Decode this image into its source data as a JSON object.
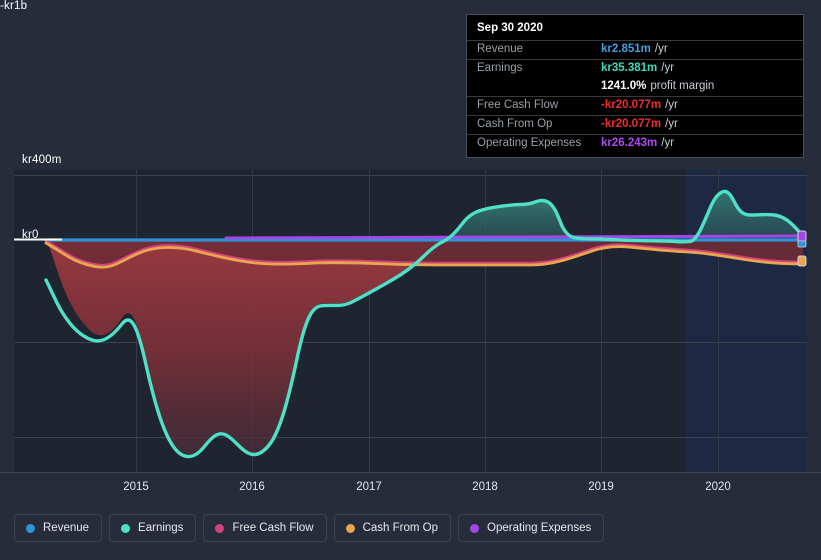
{
  "chart_data": {
    "type": "area",
    "title": "",
    "xlabel": "",
    "ylabel": "",
    "ylim": [
      -1000,
      400
    ],
    "y_ticks": [
      {
        "value": 400,
        "label": "kr400m"
      },
      {
        "value": 0,
        "label": "kr0"
      },
      {
        "value": -1000,
        "label": "-kr1b"
      }
    ],
    "x_ticks": [
      "2015",
      "2016",
      "2017",
      "2018",
      "2019",
      "2020"
    ],
    "grid": true,
    "legend_position": "bottom",
    "currency_prefix": "kr",
    "units": "millions",
    "forecast_start": "2019-10",
    "x": [
      "2014-06",
      "2014-09",
      "2014-12",
      "2015-03",
      "2015-06",
      "2015-09",
      "2015-12",
      "2016-03",
      "2016-06",
      "2016-09",
      "2016-12",
      "2017-03",
      "2017-06",
      "2017-09",
      "2017-12",
      "2018-03",
      "2018-06",
      "2018-09",
      "2018-12",
      "2019-03",
      "2019-06",
      "2019-09",
      "2019-12",
      "2020-03",
      "2020-06",
      "2020-09"
    ],
    "series": [
      {
        "name": "Revenue",
        "color": "#2f93d8",
        "values": [
          2.0,
          2.1,
          2.2,
          2.3,
          2.4,
          2.5,
          2.6,
          2.7,
          2.8,
          2.8,
          2.9,
          2.9,
          3.0,
          3.0,
          3.0,
          2.9,
          2.9,
          2.9,
          2.9,
          2.9,
          2.9,
          2.9,
          2.9,
          2.9,
          2.9,
          2.851
        ],
        "last_value": 2.851
      },
      {
        "name": "Earnings",
        "color": "#4fe0c8",
        "values": [
          -120,
          -330,
          -400,
          -390,
          -420,
          -980,
          -870,
          -960,
          -920,
          -560,
          -430,
          -400,
          -350,
          -260,
          -40,
          130,
          170,
          160,
          190,
          30,
          5,
          5,
          6,
          260,
          150,
          35.381
        ],
        "last_value": 35.381
      },
      {
        "name": "Free Cash Flow",
        "color": "#d4447c",
        "values": [
          -3,
          -12,
          -14,
          -16,
          -18,
          -18,
          -17,
          -16,
          -16,
          -17,
          -19,
          -22,
          -24,
          -25,
          -24,
          -22,
          -24,
          -24,
          -23,
          -12,
          -10,
          -10,
          -12,
          -16,
          -19,
          -20.077
        ],
        "last_value": -20.077
      },
      {
        "name": "Cash From Op",
        "color": "#eaa64f",
        "values": [
          -3,
          -12,
          -14,
          -16,
          -18,
          -18,
          -17,
          -16,
          -16,
          -17,
          -19,
          -22,
          -24,
          -25,
          -24,
          -22,
          -24,
          -24,
          -23,
          -12,
          -10,
          -10,
          -12,
          -16,
          -19,
          -20.077
        ],
        "last_value": -20.077
      },
      {
        "name": "Operating Expenses",
        "color": "#a347e8",
        "values": [
          null,
          null,
          null,
          null,
          null,
          null,
          16,
          17,
          18,
          19,
          20,
          21,
          22,
          23,
          23,
          24,
          24,
          24,
          24,
          25,
          25,
          25,
          26,
          26,
          26,
          26.243
        ],
        "last_value": 26.243
      }
    ]
  },
  "tooltip": {
    "date": "Sep 30 2020",
    "rows": [
      {
        "key": "Revenue",
        "value": "kr2.851m",
        "unit": "/yr",
        "color": "#3f9fe0",
        "rule": true
      },
      {
        "key": "Earnings",
        "value": "kr35.381m",
        "unit": "/yr",
        "color": "#3fd9b8",
        "rule": true
      },
      {
        "key": "",
        "value": "1241.0%",
        "unit": "profit margin",
        "color": "#ffffff",
        "rule": false
      },
      {
        "key": "Free Cash Flow",
        "value": "-kr20.077m",
        "unit": "/yr",
        "color": "#f22c2c",
        "rule": true
      },
      {
        "key": "Cash From Op",
        "value": "-kr20.077m",
        "unit": "/yr",
        "color": "#f22c2c",
        "rule": true
      },
      {
        "key": "Operating Expenses",
        "value": "kr26.243m",
        "unit": "/yr",
        "color": "#b048f0",
        "rule": true
      }
    ]
  },
  "axis": {
    "y_top": "kr400m",
    "y_zero": "kr0",
    "y_bottom": "-kr1b",
    "years": [
      "2015",
      "2016",
      "2017",
      "2018",
      "2019",
      "2020"
    ]
  },
  "legend": {
    "items": [
      {
        "label": "Revenue",
        "color": "#2f93d8"
      },
      {
        "label": "Earnings",
        "color": "#4fe0c8"
      },
      {
        "label": "Free Cash Flow",
        "color": "#d4447c"
      },
      {
        "label": "Cash From Op",
        "color": "#eaa64f"
      },
      {
        "label": "Operating Expenses",
        "color": "#a347e8"
      }
    ]
  },
  "colors": {
    "page_background": "#262c39",
    "plot_background": "#1e2430",
    "forecast_background": "#1b2740",
    "gridline": "#39414f",
    "zero_line": "#ffffff",
    "negative_fill": "#8c3139",
    "positive_fill": "#2d5b5c"
  }
}
